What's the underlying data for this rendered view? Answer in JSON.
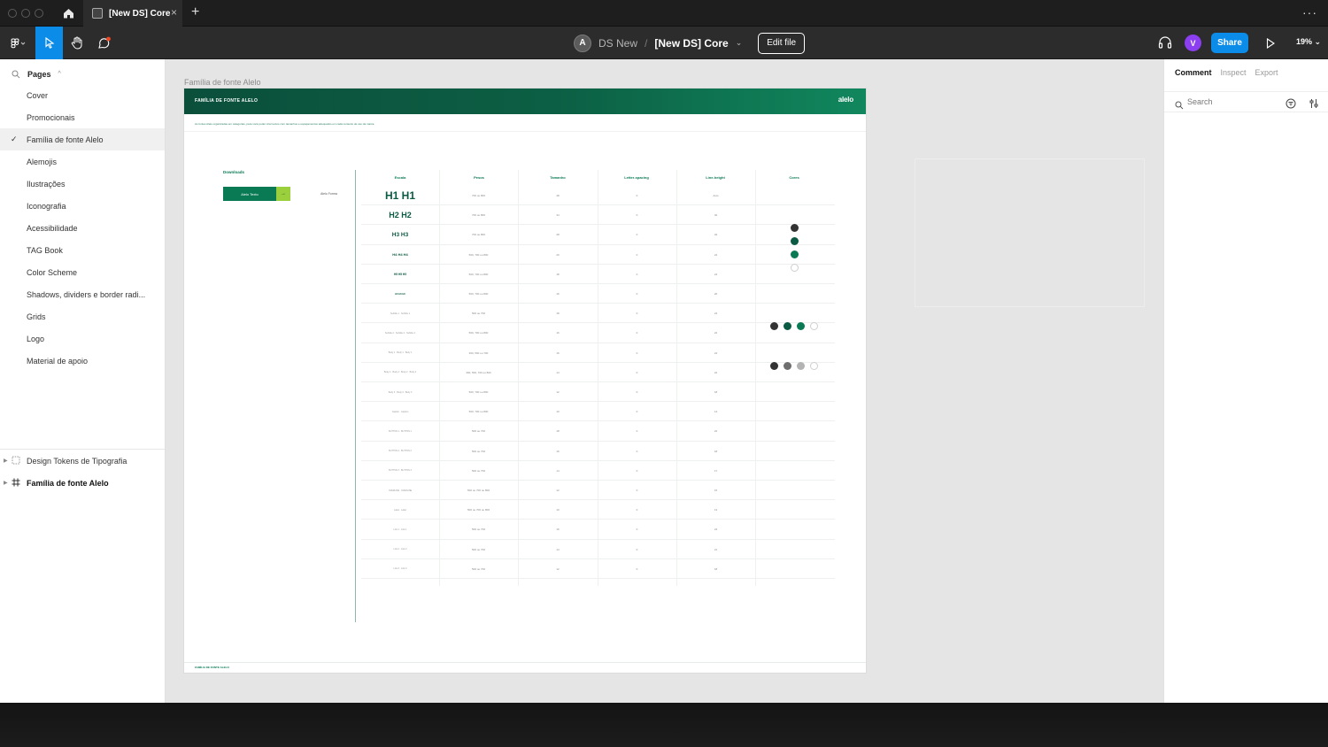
{
  "titlebar": {
    "tab_title": "[New DS] Core",
    "close_glyph": "×",
    "new_tab_glyph": "+",
    "more_glyph": "···"
  },
  "toolbar": {
    "team_initial": "A",
    "team_name": "DS New",
    "separator": "/",
    "file_name": "[New DS] Core",
    "file_caret": "⌄",
    "edit_label": "Edit file",
    "user_initial": "V",
    "share_label": "Share",
    "zoom_label": "19% ⌄",
    "accent": "#0c8ce9"
  },
  "left": {
    "pages_label": "Pages",
    "pages_caret": "^",
    "pages": [
      {
        "label": "Cover"
      },
      {
        "label": "Promocionais"
      },
      {
        "label": "Família de fonte Alelo",
        "active": true
      },
      {
        "label": "Alemojis"
      },
      {
        "label": "Ilustrações"
      },
      {
        "label": "Iconografia"
      },
      {
        "label": "Acessibilidade"
      },
      {
        "label": "TAG Book"
      },
      {
        "label": "Color Scheme"
      },
      {
        "label": "Shadows, dividers e border radi..."
      },
      {
        "label": "Grids"
      },
      {
        "label": "Logo"
      },
      {
        "label": "Material de apoio"
      }
    ],
    "check_glyph": "✓",
    "layers": [
      {
        "label": "Design Tokens de Tipografia",
        "icon": "dashed-frame-icon"
      },
      {
        "label": "Família de fonte Alelo",
        "icon": "frame-hash-icon"
      }
    ]
  },
  "right": {
    "tabs": [
      "Comment",
      "Inspect",
      "Export"
    ],
    "search_placeholder": "Search"
  },
  "canvas": {
    "frame_label": "Família de fonte Alelo",
    "header_title": "FAMÍLIA DE FONTE ALELO",
    "logo_text": "alelo",
    "intro_text": "As fontes Alelo organizadas em categorias, para você poder criar textos com tamanhos e espaçamentos adequados em cada contexto de uso da marca.",
    "downloads_label": "Downloads",
    "download_button": "Alelo Texto",
    "download_arrow": "→",
    "download_alt": "Alelo Forma",
    "columns": [
      "Escala",
      "Pesos",
      "Tamanho",
      "Letter-spacing",
      "Line-height",
      "Cores"
    ],
    "rows": [
      {
        "escala": "H1  H1",
        "style": "h1",
        "pesos": "700 ou 800",
        "tamanho": "48",
        "letter": "0",
        "lh": "Auto"
      },
      {
        "escala": "H2  H2",
        "style": "h2",
        "pesos": "700 ou 800",
        "tamanho": "34",
        "letter": "0",
        "lh": "40"
      },
      {
        "escala": "H3  H3",
        "style": "h3",
        "pesos": "700 ou 800",
        "tamanho": "28",
        "letter": "0",
        "lh": "32"
      },
      {
        "escala": "H4   H4   H4",
        "style": "h4",
        "pesos": "500, 700 ou 800",
        "tamanho": "20",
        "letter": "0",
        "lh": "24"
      },
      {
        "escala": "H5    H5    H5",
        "style": "h5",
        "pesos": "500, 700 ou 800",
        "tamanho": "18",
        "letter": "0",
        "lh": "24"
      },
      {
        "escala": "H6    H6    H6",
        "style": "h6",
        "pesos": "500, 700 ou 800",
        "tamanho": "16",
        "letter": "0",
        "lh": "20"
      },
      {
        "escala": "Subtitle 1 · Subtitle 1",
        "style": "sm",
        "pesos": "500 ou 700",
        "tamanho": "18",
        "letter": "0",
        "lh": "24"
      },
      {
        "escala": "Subtitle 2 · Subtitle 2 · Subtitle 2",
        "style": "sm",
        "pesos": "500, 700 ou 800",
        "tamanho": "16",
        "letter": "0",
        "lh": "22"
      },
      {
        "escala": "Body 1 · Body 1 · Body 1",
        "style": "sm",
        "pesos": "300, 500 ou 700",
        "tamanho": "16",
        "letter": "0",
        "lh": "24"
      },
      {
        "escala": "Body 2 · Body 2 · Body 2 · Body 2",
        "style": "sm",
        "pesos": "300, 500, 700 ou 800",
        "tamanho": "14",
        "letter": "0",
        "lh": "22"
      },
      {
        "escala": "Body 3 · Body 3 · Body 3",
        "style": "sm",
        "pesos": "500, 700 ou 800",
        "tamanho": "12",
        "letter": "0",
        "lh": "18"
      },
      {
        "escala": "Caption · Caption",
        "style": "sm",
        "pesos": "500, 700 ou 800",
        "tamanho": "10",
        "letter": "0",
        "lh": "14"
      },
      {
        "escala": "BUTTON 1 · BUTTON 1",
        "style": "sm",
        "pesos": "500 ou 700",
        "tamanho": "18",
        "letter": "0",
        "lh": "22"
      },
      {
        "escala": "BUTTON 2 · BUTTON 2",
        "style": "sm",
        "pesos": "500 ou 700",
        "tamanho": "16",
        "letter": "0",
        "lh": "18"
      },
      {
        "escala": "BUTTON 3 · BUTTON 3",
        "style": "sm",
        "pesos": "500 ou 700",
        "tamanho": "14",
        "letter": "0",
        "lh": "17"
      },
      {
        "escala": "OVERLINE · OVERLINE",
        "style": "sm",
        "pesos": "500 ou 700 ou 800",
        "tamanho": "12",
        "letter": "0",
        "lh": "15"
      },
      {
        "escala": "Label · Label",
        "style": "sm",
        "pesos": "500 ou 700 ou 800",
        "tamanho": "10",
        "letter": "0",
        "lh": "13"
      },
      {
        "escala": "Link 1 · Link 1",
        "style": "sm",
        "pesos": "500 ou 700",
        "tamanho": "16",
        "letter": "0",
        "lh": "24"
      },
      {
        "escala": "Link 2 · Link 2",
        "style": "sm",
        "pesos": "500 ou 700",
        "tamanho": "14",
        "letter": "0",
        "lh": "21"
      },
      {
        "escala": "Link 3 · Link 3",
        "style": "sm",
        "pesos": "500 ou 700",
        "tamanho": "12",
        "letter": "0",
        "lh": "18"
      }
    ],
    "color_swatches": {
      "group1": [
        "#333333",
        "#0b5a43",
        "#0a7a55",
        "#ffffff"
      ],
      "group2": [
        "#333333",
        "#0b5a43",
        "#0a7a55",
        "#ffffff"
      ],
      "group3": [
        "#333333",
        "#6e6e6e",
        "#b3b3b3",
        "#ffffff"
      ]
    },
    "footer_text": "FAMÍLIA DE FONTE ALELO"
  }
}
